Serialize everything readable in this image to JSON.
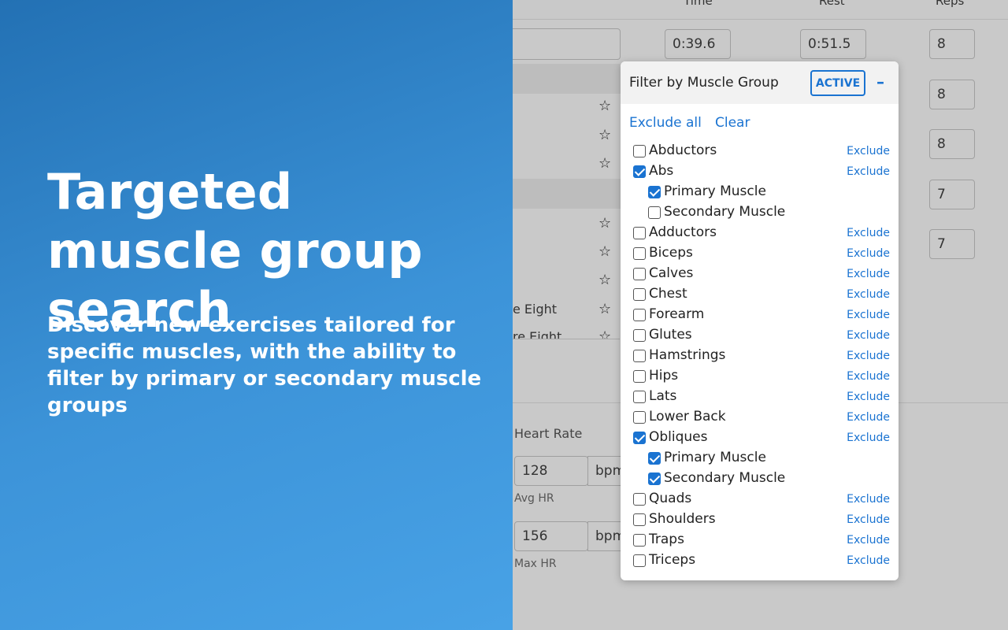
{
  "promo": {
    "title": "Targeted muscle group search",
    "subtitle": "Discover new exercises tailored for specific muscles, with the ability to filter by primary or secondary muscle groups"
  },
  "background": {
    "columns": [
      "Time",
      "Rest",
      "Reps"
    ],
    "first_row": {
      "time": "0:39.6",
      "rest": "0:51.5",
      "reps": "8"
    },
    "reps_values": [
      "8",
      "8",
      "8",
      "7",
      "7"
    ],
    "star_glyph": "☆",
    "partial_labels": [
      "e Eight",
      "re Eight"
    ],
    "heart_rate_label": "Heart Rate",
    "avg_hr": {
      "value": "128",
      "unit": "bpm",
      "label": "Avg HR"
    },
    "max_hr": {
      "value": "156",
      "unit": "bpm",
      "label": "Max HR"
    }
  },
  "filter": {
    "title": "Filter by Muscle Group",
    "status": "ACTIVE",
    "collapse": "–",
    "exclude_all": "Exclude all",
    "clear": "Clear",
    "exclude_label": "Exclude",
    "groups": [
      {
        "name": "Abductors",
        "checked": false,
        "level": 0,
        "exclude": true
      },
      {
        "name": "Abs",
        "checked": true,
        "level": 0,
        "exclude": true
      },
      {
        "name": "Primary Muscle",
        "checked": true,
        "level": 1,
        "exclude": false
      },
      {
        "name": "Secondary Muscle",
        "checked": false,
        "level": 1,
        "exclude": false
      },
      {
        "name": "Adductors",
        "checked": false,
        "level": 0,
        "exclude": true
      },
      {
        "name": "Biceps",
        "checked": false,
        "level": 0,
        "exclude": true
      },
      {
        "name": "Calves",
        "checked": false,
        "level": 0,
        "exclude": true
      },
      {
        "name": "Chest",
        "checked": false,
        "level": 0,
        "exclude": true
      },
      {
        "name": "Forearm",
        "checked": false,
        "level": 0,
        "exclude": true
      },
      {
        "name": "Glutes",
        "checked": false,
        "level": 0,
        "exclude": true
      },
      {
        "name": "Hamstrings",
        "checked": false,
        "level": 0,
        "exclude": true
      },
      {
        "name": "Hips",
        "checked": false,
        "level": 0,
        "exclude": true
      },
      {
        "name": "Lats",
        "checked": false,
        "level": 0,
        "exclude": true
      },
      {
        "name": "Lower Back",
        "checked": false,
        "level": 0,
        "exclude": true
      },
      {
        "name": "Obliques",
        "checked": true,
        "level": 0,
        "exclude": true
      },
      {
        "name": "Primary Muscle",
        "checked": true,
        "level": 1,
        "exclude": false
      },
      {
        "name": "Secondary Muscle",
        "checked": true,
        "level": 1,
        "exclude": false
      },
      {
        "name": "Quads",
        "checked": false,
        "level": 0,
        "exclude": true
      },
      {
        "name": "Shoulders",
        "checked": false,
        "level": 0,
        "exclude": true
      },
      {
        "name": "Traps",
        "checked": false,
        "level": 0,
        "exclude": true
      },
      {
        "name": "Triceps",
        "checked": false,
        "level": 0,
        "exclude": true
      }
    ]
  },
  "colors": {
    "accent": "#1a73d1",
    "promo_gradient_start": "#2371b4",
    "promo_gradient_end": "#48a2e6",
    "dim_background": "#c9c9c9"
  }
}
